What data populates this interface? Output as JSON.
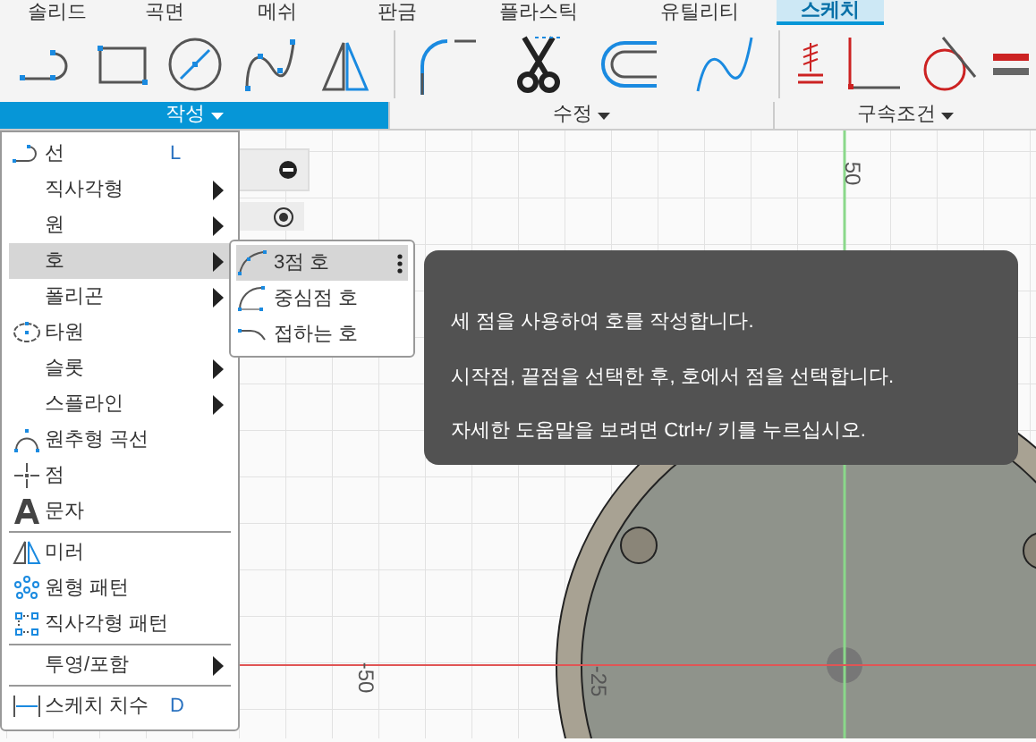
{
  "tabs": [
    {
      "label": "솔리드",
      "selected": false
    },
    {
      "label": "곡면",
      "selected": false
    },
    {
      "label": "메쉬",
      "selected": false
    },
    {
      "label": "판금",
      "selected": false
    },
    {
      "label": "플라스틱",
      "selected": false
    },
    {
      "label": "유틸리티",
      "selected": false
    },
    {
      "label": "스케치",
      "selected": true
    }
  ],
  "toolbar_groups": [
    {
      "label": "작성",
      "selected": true
    },
    {
      "label": "수정",
      "selected": false
    },
    {
      "label": "구속조건",
      "selected": false
    }
  ],
  "menu": [
    {
      "kind": "item",
      "label": "선",
      "shortcut": "L",
      "submenu": false,
      "selected": false
    },
    {
      "kind": "item",
      "label": "직사각형",
      "submenu": true,
      "selected": false
    },
    {
      "kind": "item",
      "label": "원",
      "submenu": true,
      "selected": false
    },
    {
      "kind": "item",
      "label": "호",
      "submenu": true,
      "selected": true,
      "children": [
        {
          "label": "3점 호",
          "selected": true
        },
        {
          "label": "중심점 호",
          "selected": false
        },
        {
          "label": "접하는 호",
          "selected": false
        }
      ]
    },
    {
      "kind": "item",
      "label": "폴리곤",
      "submenu": true,
      "selected": false
    },
    {
      "kind": "item",
      "label": "타원",
      "submenu": false,
      "selected": false
    },
    {
      "kind": "item",
      "label": "슬롯",
      "submenu": true,
      "selected": false
    },
    {
      "kind": "item",
      "label": "스플라인",
      "submenu": true,
      "selected": false
    },
    {
      "kind": "item",
      "label": "원추형 곡선",
      "submenu": false,
      "selected": false
    },
    {
      "kind": "item",
      "label": "점",
      "submenu": false,
      "selected": false
    },
    {
      "kind": "item",
      "label": "문자",
      "submenu": false,
      "selected": false
    },
    {
      "kind": "separator"
    },
    {
      "kind": "item",
      "label": "미러",
      "submenu": false,
      "selected": false
    },
    {
      "kind": "item",
      "label": "원형 패턴",
      "submenu": false,
      "selected": false
    },
    {
      "kind": "item",
      "label": "직사각형 패턴",
      "submenu": false,
      "selected": false
    },
    {
      "kind": "separator"
    },
    {
      "kind": "item",
      "label": "투영/포함",
      "submenu": true,
      "selected": false
    },
    {
      "kind": "separator"
    },
    {
      "kind": "item",
      "label": "스케치 치수",
      "shortcut": "D",
      "submenu": false,
      "selected": false
    }
  ],
  "tooltip": {
    "lines": [
      "세 점을 사용하여 호를 작성합니다.",
      "시작점, 끝점을 선택한 후, 호에서 점을 선택합니다.",
      "자세한 도움말을 보려면 Ctrl+/ 키를 누르십시오."
    ]
  },
  "canvas": {
    "axis_labels": [
      "50",
      "-50",
      "-25"
    ]
  }
}
